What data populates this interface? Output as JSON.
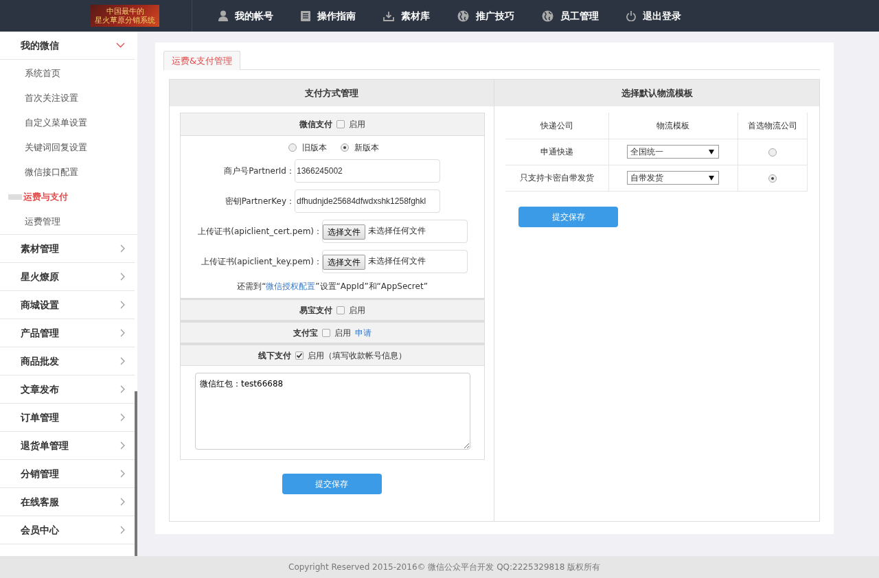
{
  "header": {
    "logo_lines": [
      "中国最牛的",
      "星火草原分销系统"
    ],
    "nav": [
      {
        "label": "我的帐号"
      },
      {
        "label": "操作指南"
      },
      {
        "label": "素材库"
      },
      {
        "label": "推广技巧"
      },
      {
        "label": "员工管理"
      },
      {
        "label": "退出登录"
      }
    ]
  },
  "sidebar": {
    "groups": [
      {
        "label": "我的微信",
        "expanded": true,
        "children": [
          {
            "label": "系统首页",
            "selected": false
          },
          {
            "label": "首次关注设置",
            "selected": false
          },
          {
            "label": "自定义菜单设置",
            "selected": false
          },
          {
            "label": "关键词回复设置",
            "selected": false
          },
          {
            "label": "微信接口配置",
            "selected": false
          },
          {
            "label": "运费与支付",
            "selected": true
          },
          {
            "label": "运费管理",
            "selected": false
          }
        ]
      },
      {
        "label": "素材管理",
        "expanded": false
      },
      {
        "label": "星火燎原",
        "expanded": false
      },
      {
        "label": "商城设置",
        "expanded": false
      },
      {
        "label": "产品管理",
        "expanded": false
      },
      {
        "label": "商品批发",
        "expanded": false
      },
      {
        "label": "文章发布",
        "expanded": false
      },
      {
        "label": "订单管理",
        "expanded": false
      },
      {
        "label": "退货单管理",
        "expanded": false
      },
      {
        "label": "分销管理",
        "expanded": false
      },
      {
        "label": "在线客服",
        "expanded": false
      },
      {
        "label": "会员中心",
        "expanded": false
      }
    ]
  },
  "tabs": [
    {
      "label": "运费&支付管理",
      "selected": true
    }
  ],
  "payment": {
    "title": "支付方式管理",
    "sections": [
      {
        "kind": "wechat",
        "title": "微信支付",
        "enable_label": "启用",
        "checked": false,
        "versions": [
          {
            "label": "旧版本",
            "selected": false
          },
          {
            "label": "新版本",
            "selected": true
          }
        ],
        "fields": [
          {
            "label": "商户号PartnerId：",
            "value": "1366245002"
          },
          {
            "label": "密钥PartnerKey：",
            "value": "dfhudnjde25684dfwdxshk1258fghkl"
          }
        ],
        "uploads": [
          {
            "label": "上传证书(apiclient_cert.pem)：",
            "button": "选择文件",
            "status": "未选择任何文件"
          },
          {
            "label": "上传证书(apiclient_key.pem)：",
            "button": "选择文件",
            "status": "未选择任何文件"
          }
        ],
        "note_before": "还需到“",
        "note_link": "微信授权配置",
        "note_after": "”设置“AppId”和“AppSecret”"
      },
      {
        "kind": "simple",
        "title": "易宝支付",
        "enable_label": "启用",
        "checked": false
      },
      {
        "kind": "link",
        "title": "支付宝",
        "enable_label": "启用",
        "checked": false,
        "link": "申请"
      },
      {
        "kind": "offline",
        "title": "线下支付",
        "enable_label": "启用（填写收款帐号信息）",
        "checked": true,
        "text": "微信红包：test66688"
      }
    ],
    "save": "提交保存"
  },
  "logistics": {
    "title": "选择默认物流模板",
    "columns": [
      "快递公司",
      "物流模板",
      "首选物流公司"
    ],
    "rows": [
      {
        "company": "申通快递",
        "template": "全国统一",
        "selected": false
      },
      {
        "company": "只支持卡密自带发货",
        "template": "自带发货",
        "selected": true
      }
    ],
    "save": "提交保存"
  },
  "footer": "Copyright Reserved 2015-2016© 微信公众平台开发 QQ:2225329818 版权所有"
}
